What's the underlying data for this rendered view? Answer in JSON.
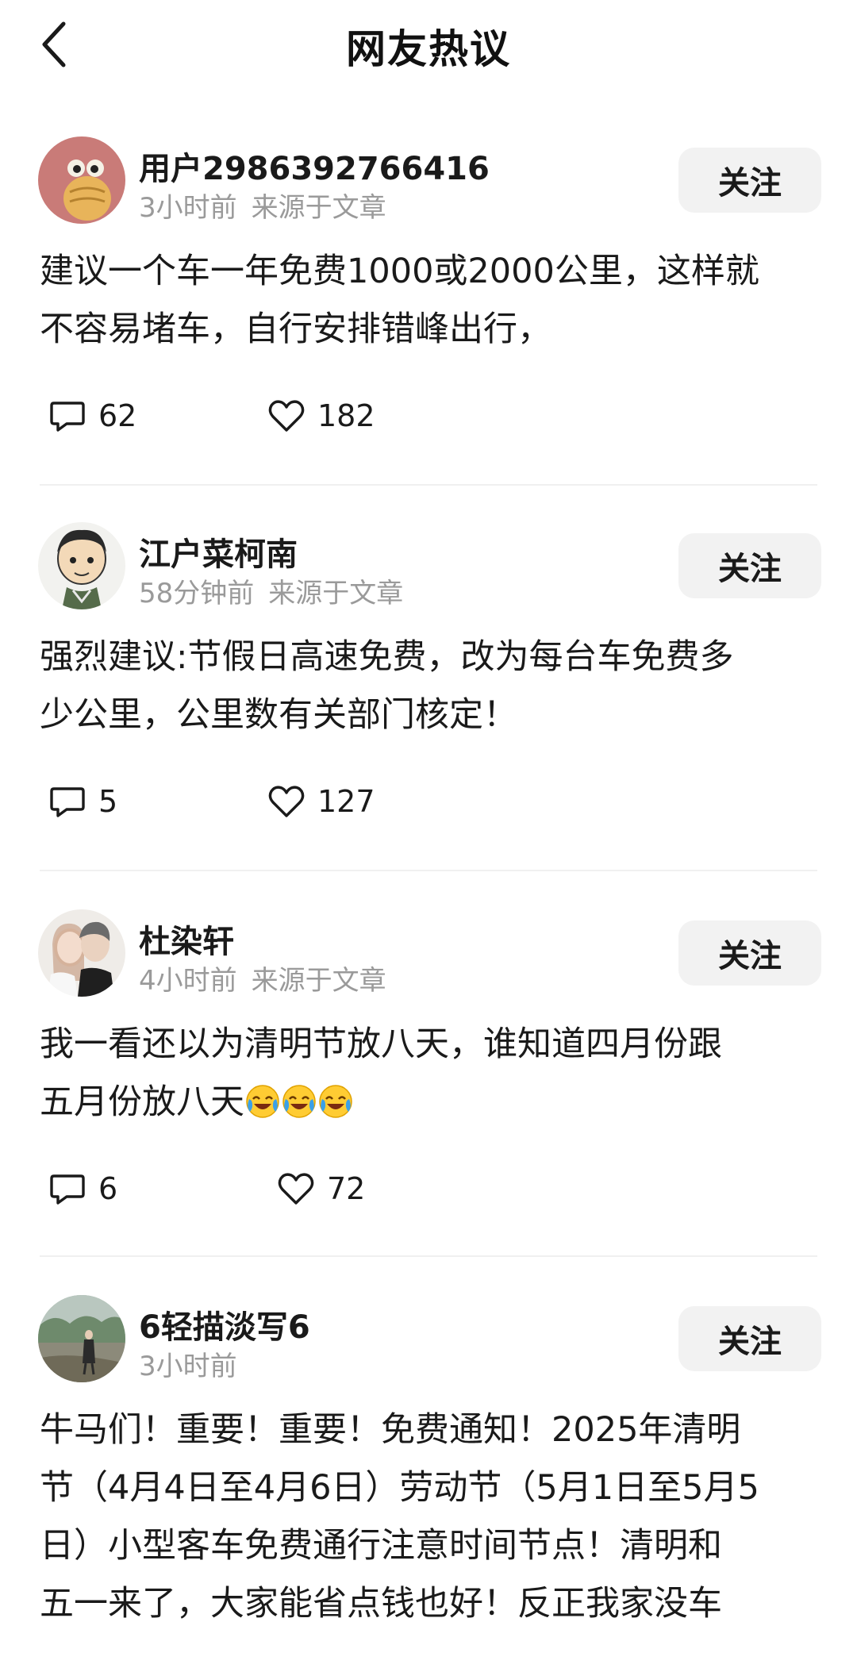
{
  "header": {
    "title": "网友热议"
  },
  "comments": [
    {
      "user": "用户2986392766416",
      "time": "3小时前",
      "source": "来源于文章",
      "follow_label": "关注",
      "text_line1": "建议一个车一年免费1000或2000公里，这样就",
      "text_line2": "不容易堵车，自行安排错峰出行，",
      "reply_count": "62",
      "like_count": "182"
    },
    {
      "user": "江户菜柯南",
      "time": "58分钟前",
      "source": "来源于文章",
      "follow_label": "关注",
      "text_line1": "强烈建议:节假日高速免费，改为每台车免费多",
      "text_line2": "少公里，公里数有关部门核定！",
      "reply_count": "5",
      "like_count": "127"
    },
    {
      "user": "杜染轩",
      "time": "4小时前",
      "source": "来源于文章",
      "follow_label": "关注",
      "text_line1": "我一看还以为清明节放八天，谁知道四月份跟",
      "text_line2": "五月份放八天",
      "emoji": "crying-laughing",
      "reply_count": "6",
      "like_count": "72"
    },
    {
      "user": "6轻描淡写6",
      "time": "3小时前",
      "follow_label": "关注",
      "text_line1": "牛马们！重要！重要！免费通知！2025年清明",
      "text_line2": "节（4月4日至4月6日）劳动节（5月1日至5月5",
      "text_line3": "日）小型客车免费通行注意时间节点！清明和",
      "text_line4": "五一来了，大家能省点钱也好！反正我家没车"
    }
  ],
  "colors": {
    "text": "#1a1a1a",
    "meta": "#9a9a9a",
    "follow_bg": "#f2f2f2",
    "divider": "#f0f0f0"
  }
}
